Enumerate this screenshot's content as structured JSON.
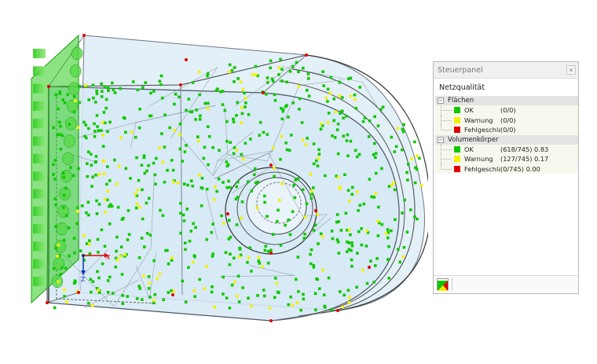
{
  "colors": {
    "ok": "#10c800",
    "warning": "#f2f200",
    "error": "#e00000",
    "mesh_fill": "#dcedf7",
    "support": "#2ecc1e"
  },
  "axes": {
    "x": "X",
    "z": "Z"
  },
  "panel": {
    "title": "Steuerpanel",
    "subtitle": "Netzqualität",
    "close_icon": "close-icon",
    "groups": [
      {
        "label": "Flächen",
        "rows": [
          {
            "label": "OK",
            "value": "(0/0)",
            "color": "#10c800"
          },
          {
            "label": "Warnung",
            "value": "(0/0)",
            "color": "#f2f200"
          },
          {
            "label": "Fehlgeschlagen",
            "value": "(0/0)",
            "color": "#e00000"
          }
        ]
      },
      {
        "label": "Volumenkörper",
        "rows": [
          {
            "label": "OK",
            "value": "(618/745) 0.83",
            "color": "#10c800"
          },
          {
            "label": "Warnung",
            "value": "(127/745) 0.17",
            "color": "#f2f200"
          },
          {
            "label": "Fehlgeschlagen",
            "value": "(0/745) 0.00",
            "color": "#e00000"
          }
        ]
      }
    ]
  }
}
